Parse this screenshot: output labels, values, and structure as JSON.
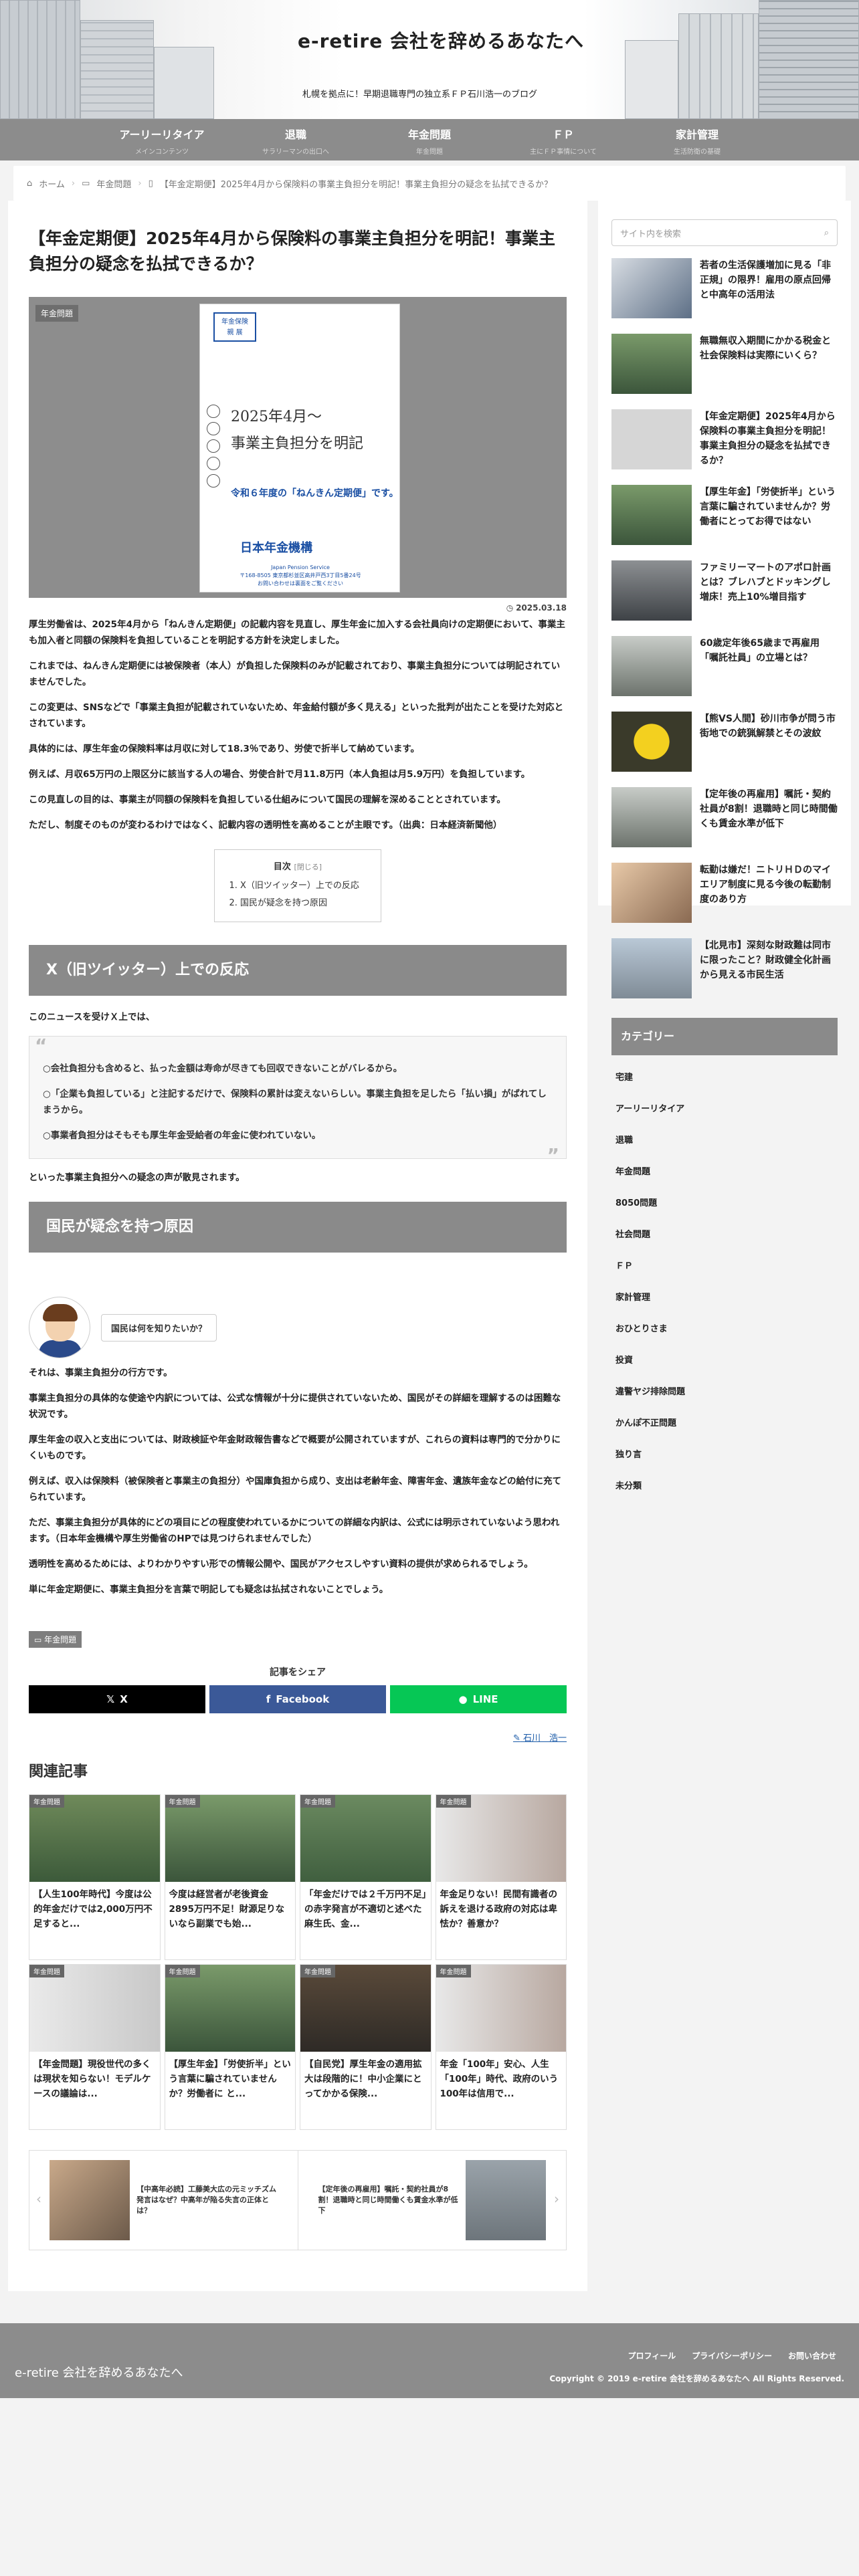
{
  "site": {
    "title": "e-retire 会社を辞めるあなたへ",
    "tagline": "札幌を拠点に！早期退職専門の独立系ＦＰ石川浩一のブログ"
  },
  "nav": [
    {
      "label": "アーリーリタイア",
      "sub": "メインコンテンツ"
    },
    {
      "label": "退職",
      "sub": "サラリーマンの出口へ"
    },
    {
      "label": "年金問題",
      "sub": "年金問題"
    },
    {
      "label": "ＦＰ",
      "sub": "主にＦＰ事情について"
    },
    {
      "label": "家計管理",
      "sub": "生活防衛の基礎"
    }
  ],
  "breadcrumb": {
    "home": "ホーム",
    "cat": "年金問題",
    "current": "【年金定期便】2025年4月から保険料の事業主負担分を明記！事業主負担分の疑念を払拭できるか？"
  },
  "article": {
    "title": "【年金定期便】2025年4月から保険料の事業主負担分を明記！事業主負担分の疑念を払拭できるか？",
    "category": "年金問題",
    "date": "2025.03.18",
    "poster": {
      "box1": "年金保険",
      "box2": "親 展",
      "date": "2025年4月～",
      "headline": "事業主負担分を明記",
      "blue": "令和６年度の「ねんきん定期便」です。",
      "small": "",
      "org": "日本年金機構",
      "org_en": "Japan Pension Service",
      "address": "〒168-8505 東京都杉並区高井戸西3丁目5番24号",
      "contact": "お問い合わせは裏面をご覧ください"
    },
    "paragraphs_intro": [
      "厚生労働省は、2025年4月から「ねんきん定期便」の記載内容を見直し、厚生年金に加入する会社員向けの定期便において、事業主も加入者と同額の保険料を負担していることを明記する方針を決定しました。",
      "これまでは、ねんきん定期便には被保険者（本人）が負担した保険料のみが記載されており、事業主負担分については明記されていませんでした。",
      "この変更は、SNSなどで「事業主負担が記載されていないため、年金給付額が多く見える」といった批判が出たことを受けた対応とされています。",
      "具体的には、厚生年金の保険料率は月収に対して18.3％であり、労使で折半して納めています。",
      "例えば、月収65万円の上限区分に該当する人の場合、労使合計で月11.8万円（本人負担は月5.9万円）を負担しています。",
      "この見直しの目的は、事業主が同額の保険料を負担している仕組みについて国民の理解を深めることとされています。",
      "ただし、制度そのものが変わるわけではなく、記載内容の透明性を高めることが主眼です。（出典：日本経済新聞他）"
    ],
    "toc": {
      "title": "目次",
      "toggle": "[閉じる]",
      "items": [
        "X（旧ツイッター）上での反応",
        "国民が疑念を持つ原因"
      ]
    },
    "h2_1": "X（旧ツイッター）上での反応",
    "after_h2_1": "このニュースを受けＸ上では、",
    "quotes": [
      "○会社負担分も含めると、払った金額は寿命が尽きても回収できないことがバレるから。",
      "○「企業も負担している」と注記するだけで、保険料の累計は変えないらしい。事業主負担を足したら「払い損」がばれてしまうから。",
      "○事業者負担分はそもそも厚生年金受給者の年金に使われていない。"
    ],
    "after_quote": "といった事業主負担分への疑念の声が散見されます。",
    "h2_2": "国民が疑念を持つ原因",
    "balloon": "国民は何を知りたいか？",
    "paragraphs_2": [
      "それは、事業主負担分の行方です。",
      "事業主負担分の具体的な使途や内訳については、公式な情報が十分に提供されていないため、国民がその詳細を理解するのは困難な状況です。",
      "厚生年金の収入と支出については、財政検証や年金財政報告書などで概要が公開されていますが、これらの資料は専門的で分かりにくいものです。",
      "例えば、収入は保険料（被保険者と事業主の負担分）や国庫負担から成り、支出は老齢年金、障害年金、遺族年金などの給付に充てられています。",
      "ただ、事業主負担分が具体的にどの項目にどの程度使われているかについての詳細な内訳は、公式には明示されていないよう思われます。（日本年金機構や厚生労働省のHPでは見つけられませんでした）",
      "透明性を高めるためには、よりわかりやすい形での情報公開や、国民がアクセスしやすい資料の提供が求められるでしょう。",
      "単に年金定期便に、事業主負担分を言葉で明記しても疑念は払拭されないことでしょう。"
    ],
    "share_title": "記事をシェア",
    "share_x": "X",
    "share_fb": "Facebook",
    "share_line": "LINE",
    "author": "石川　浩一"
  },
  "related": {
    "heading": "関連記事",
    "cards": [
      {
        "cat": "年金問題",
        "title": "【人生100年時代】今度は公的年金だけでは2,000万円不足すると..."
      },
      {
        "cat": "年金問題",
        "title": "今度は経営者が老後資金2895万円不足！財源足りないなら副業でも始..."
      },
      {
        "cat": "年金問題",
        "title": "「年金だけでは２千万円不足」の赤字発言が不適切と述べた麻生氏、金..."
      },
      {
        "cat": "年金問題",
        "title": "年金足りない！民間有識者の訴えを退ける政府の対応は卑怯か？善意か？"
      },
      {
        "cat": "年金問題",
        "title": "【年金問題】現役世代の多くは現状を知らない！モデルケースの議論は..."
      },
      {
        "cat": "年金問題",
        "title": "【厚生年金】「労使折半」という言葉に騙されていませんか？労働者に と..."
      },
      {
        "cat": "年金問題",
        "title": "【自民党】厚生年金の適用拡大は段階的に！中小企業にとってかかる保険..."
      },
      {
        "cat": "年金問題",
        "title": "年金「100年」安心、人生「100年」時代、政府のいう100年は信用で..."
      }
    ]
  },
  "pager": {
    "prev": "【中高年必読】工藤美大広の元ミッチズム発言はなぜ？中高年が陥る失言の正体とは？",
    "next": "【定年後の再雇用】嘱託・契約社員が8割！退職時と同じ時間働くも賃金水準が低下"
  },
  "sidebar": {
    "search_placeholder": "サイト内を検索",
    "posts": [
      "若者の生活保護増加に見る「非正規」の限界！雇用の原点回帰と中高年の活用法",
      "無職無収入期間にかかる税金と社会保険料は実際にいくら？",
      "【年金定期便】2025年4月から保険料の事業主負担分を明記！事業主負担分の疑念を払拭できるか？",
      "【厚生年金】「労使折半」という言葉に騙されていませんか？労働者にとってお得ではない",
      "ファミリーマートのアポロ計画とは？ブレハブとドッキングし増床！売上10%増目指す",
      "60歳定年後65歳まで再雇用「嘱託社員」の立場とは？",
      "【熊VS人間】砂川市争が問う市街地での銃猟解禁とその波紋",
      "【定年後の再雇用】嘱託・契約社員が8割！退職時と同じ時間働くも賃金水準が低下",
      "転勤は嫌だ！ニトリＨＤのマイエリア制度に見る今後の転勤制度のあり方",
      "【北見市】深刻な財政難は同市に限ったこと？財政健全化計画から見える市民生活"
    ],
    "category_heading": "カテゴリー",
    "categories": [
      "宅建",
      "アーリーリタイア",
      "退職",
      "年金問題",
      "8050問題",
      "社会問題",
      "ＦＰ",
      "家計管理",
      "おひとりさま",
      "投資",
      "違警ヤジ排除問題",
      "かんぽ不正問題",
      "独り言",
      "未分類"
    ]
  },
  "footer": {
    "logo": "e-retire 会社を辞めるあなたへ",
    "links": [
      "プロフィール",
      "プライバシーポリシー",
      "お問い合わせ"
    ],
    "copyright": "Copyright © 2019 e-retire 会社を辞めるあなたへ All Rights Reserved."
  }
}
